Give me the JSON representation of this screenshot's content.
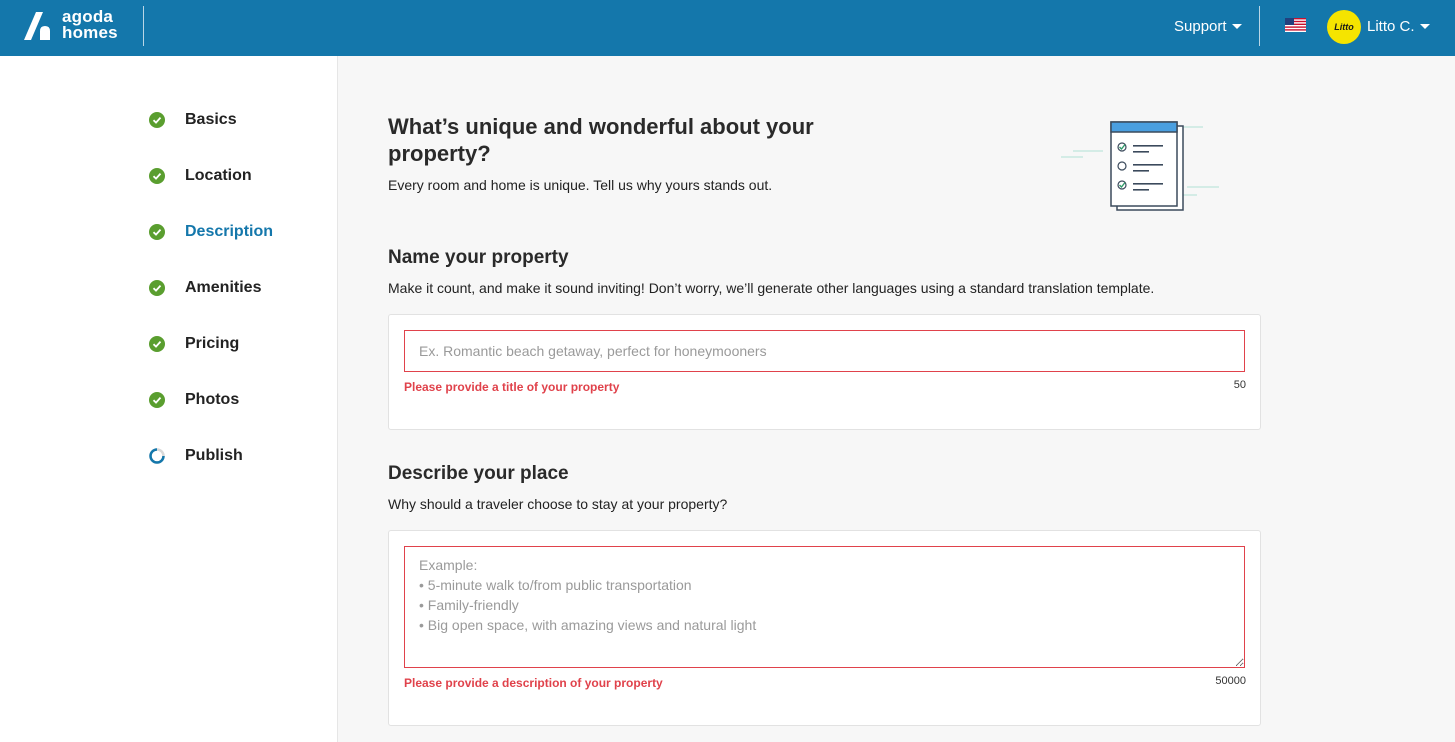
{
  "header": {
    "brand_line1": "agoda",
    "brand_line2": "homes",
    "support_label": "Support",
    "avatar_text": "Litto",
    "user_name": "Litto C.",
    "bg_color": "#1477ab"
  },
  "sidebar": {
    "steps": [
      {
        "label": "Basics",
        "status": "complete"
      },
      {
        "label": "Location",
        "status": "complete"
      },
      {
        "label": "Description",
        "status": "current"
      },
      {
        "label": "Amenities",
        "status": "complete"
      },
      {
        "label": "Pricing",
        "status": "complete"
      },
      {
        "label": "Photos",
        "status": "complete"
      },
      {
        "label": "Publish",
        "status": "in-progress"
      }
    ],
    "complete_color": "#5a9e2f",
    "active_color": "#1477ab"
  },
  "main": {
    "title": "What’s unique and wonderful about your property?",
    "subtitle": "Every room and home is unique. Tell us why yours stands out.",
    "name_section": {
      "heading": "Name your property",
      "description": "Make it count, and make it sound inviting! Don’t worry, we’ll generate other languages using a standard translation template.",
      "placeholder": "Ex. Romantic beach getaway, perfect for honeymooners",
      "value": "",
      "error": "Please provide a title of your property",
      "char_count": "50"
    },
    "describe_section": {
      "heading": "Describe your place",
      "description": "Why should a traveler choose to stay at your property?",
      "placeholder": "Example:\n• 5-minute walk to/from public transportation\n• Family-friendly\n• Big open space, with amazing views and natural light",
      "value": "",
      "error": "Please provide a description of your property",
      "char_count": "50000"
    },
    "error_color": "#e0424b"
  }
}
